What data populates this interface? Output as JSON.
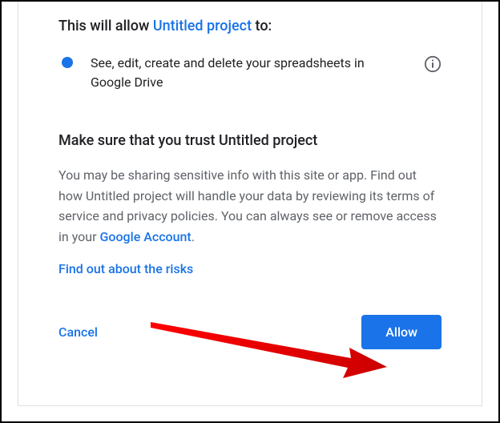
{
  "heading": {
    "prefix": "This will allow ",
    "project_name": "Untitled project",
    "suffix": " to:"
  },
  "permission": {
    "text": "See, edit, create and delete your spreadsheets in Google Drive"
  },
  "trust": {
    "heading": "Make sure that you trust Untitled project",
    "body_prefix": "You may be sharing sensitive info with this site or app. Find out how Untitled project will handle your data by reviewing its terms of service and privacy policies. You can always see or remove access in your ",
    "account_link": "Google Account",
    "body_suffix": "."
  },
  "risks_link": "Find out about the risks",
  "buttons": {
    "cancel": "Cancel",
    "allow": "Allow"
  }
}
